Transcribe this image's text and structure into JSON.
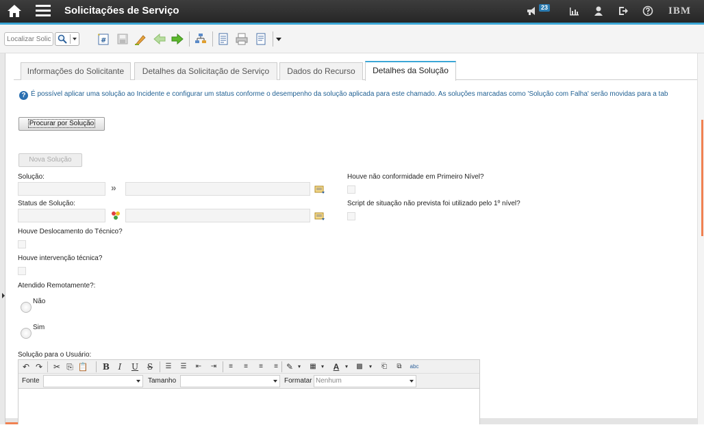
{
  "header": {
    "title": "Solicitações de Serviço",
    "notification_count": "23",
    "brand": "IBM"
  },
  "toolbar": {
    "search_placeholder": "Localizar Solic"
  },
  "tabs": [
    {
      "label": "Informações do Solicitante",
      "active": false
    },
    {
      "label": "Detalhes da Solicitação de Serviço",
      "active": false
    },
    {
      "label": "Dados do Recurso",
      "active": false
    },
    {
      "label": "Detalhes da Solução",
      "active": true
    }
  ],
  "info_message": "É possível aplicar uma solução ao Incidente e configurar um status conforme o desempenho da solução aplicada para este chamado. As soluções marcadas como 'Solução com Falha' serão movidas para a tab",
  "buttons": {
    "search_solution": "Procurar por Solução",
    "new_solution": "Nova Solução"
  },
  "form": {
    "solution_label": "Solução:",
    "solution_status_label": "Status de Solução:",
    "first_level_nonconformity_label": "Houve não conformidade em Primeiro Nível?",
    "script_label": "Script de situação não prevista foi utilizado pelo 1º nível?",
    "technician_travel_label": "Houve Deslocamento do Técnico?",
    "technical_intervention_label": "Houve intervenção técnica?",
    "remote_label": "Atendido Remotamente?:",
    "remote_options": [
      "Não",
      "Sim"
    ],
    "user_solution_label": "Solução para o Usuário:"
  },
  "editor": {
    "font_label": "Fonte",
    "size_label": "Tamanho",
    "format_label": "Formatar",
    "format_value": "Nenhum"
  }
}
